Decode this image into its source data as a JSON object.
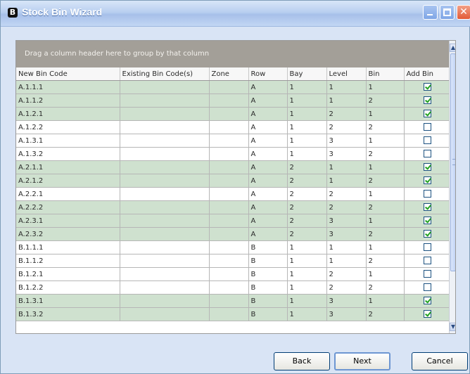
{
  "window": {
    "title": "Stock Bin Wizard",
    "icon": "app-icon",
    "controls": {
      "minimize": "minimize-icon",
      "maximize": "maximize-icon",
      "close": "✕"
    }
  },
  "grid": {
    "group_panel_text": "Drag a column header here to group by that column",
    "columns": [
      "New Bin Code",
      "Existing Bin Code(s)",
      "Zone",
      "Row",
      "Bay",
      "Level",
      "Bin",
      "Add Bin"
    ],
    "rows": [
      {
        "code": "A.1.1.1",
        "existing": "",
        "zone": "",
        "row": "A",
        "bay": "1",
        "level": "1",
        "bin": "1",
        "add": true
      },
      {
        "code": "A.1.1.2",
        "existing": "",
        "zone": "",
        "row": "A",
        "bay": "1",
        "level": "1",
        "bin": "2",
        "add": true
      },
      {
        "code": "A.1.2.1",
        "existing": "",
        "zone": "",
        "row": "A",
        "bay": "1",
        "level": "2",
        "bin": "1",
        "add": true
      },
      {
        "code": "A.1.2.2",
        "existing": "",
        "zone": "",
        "row": "A",
        "bay": "1",
        "level": "2",
        "bin": "2",
        "add": false
      },
      {
        "code": "A.1.3.1",
        "existing": "",
        "zone": "",
        "row": "A",
        "bay": "1",
        "level": "3",
        "bin": "1",
        "add": false
      },
      {
        "code": "A.1.3.2",
        "existing": "",
        "zone": "",
        "row": "A",
        "bay": "1",
        "level": "3",
        "bin": "2",
        "add": false
      },
      {
        "code": "A.2.1.1",
        "existing": "",
        "zone": "",
        "row": "A",
        "bay": "2",
        "level": "1",
        "bin": "1",
        "add": true
      },
      {
        "code": "A.2.1.2",
        "existing": "",
        "zone": "",
        "row": "A",
        "bay": "2",
        "level": "1",
        "bin": "2",
        "add": true
      },
      {
        "code": "A.2.2.1",
        "existing": "",
        "zone": "",
        "row": "A",
        "bay": "2",
        "level": "2",
        "bin": "1",
        "add": false
      },
      {
        "code": "A.2.2.2",
        "existing": "",
        "zone": "",
        "row": "A",
        "bay": "2",
        "level": "2",
        "bin": "2",
        "add": true
      },
      {
        "code": "A.2.3.1",
        "existing": "",
        "zone": "",
        "row": "A",
        "bay": "2",
        "level": "3",
        "bin": "1",
        "add": true
      },
      {
        "code": "A.2.3.2",
        "existing": "",
        "zone": "",
        "row": "A",
        "bay": "2",
        "level": "3",
        "bin": "2",
        "add": true
      },
      {
        "code": "B.1.1.1",
        "existing": "",
        "zone": "",
        "row": "B",
        "bay": "1",
        "level": "1",
        "bin": "1",
        "add": false
      },
      {
        "code": "B.1.1.2",
        "existing": "",
        "zone": "",
        "row": "B",
        "bay": "1",
        "level": "1",
        "bin": "2",
        "add": false
      },
      {
        "code": "B.1.2.1",
        "existing": "",
        "zone": "",
        "row": "B",
        "bay": "1",
        "level": "2",
        "bin": "1",
        "add": false
      },
      {
        "code": "B.1.2.2",
        "existing": "",
        "zone": "",
        "row": "B",
        "bay": "1",
        "level": "2",
        "bin": "2",
        "add": false
      },
      {
        "code": "B.1.3.1",
        "existing": "",
        "zone": "",
        "row": "B",
        "bay": "1",
        "level": "3",
        "bin": "1",
        "add": true
      },
      {
        "code": "B.1.3.2",
        "existing": "",
        "zone": "",
        "row": "B",
        "bay": "1",
        "level": "3",
        "bin": "2",
        "add": true
      }
    ],
    "colors": {
      "selected_row": "#cfe1cf",
      "unselected_row": "#ffffff",
      "group_panel": "#a39f98"
    }
  },
  "buttons": {
    "back": "Back",
    "next": "Next",
    "cancel": "Cancel"
  }
}
